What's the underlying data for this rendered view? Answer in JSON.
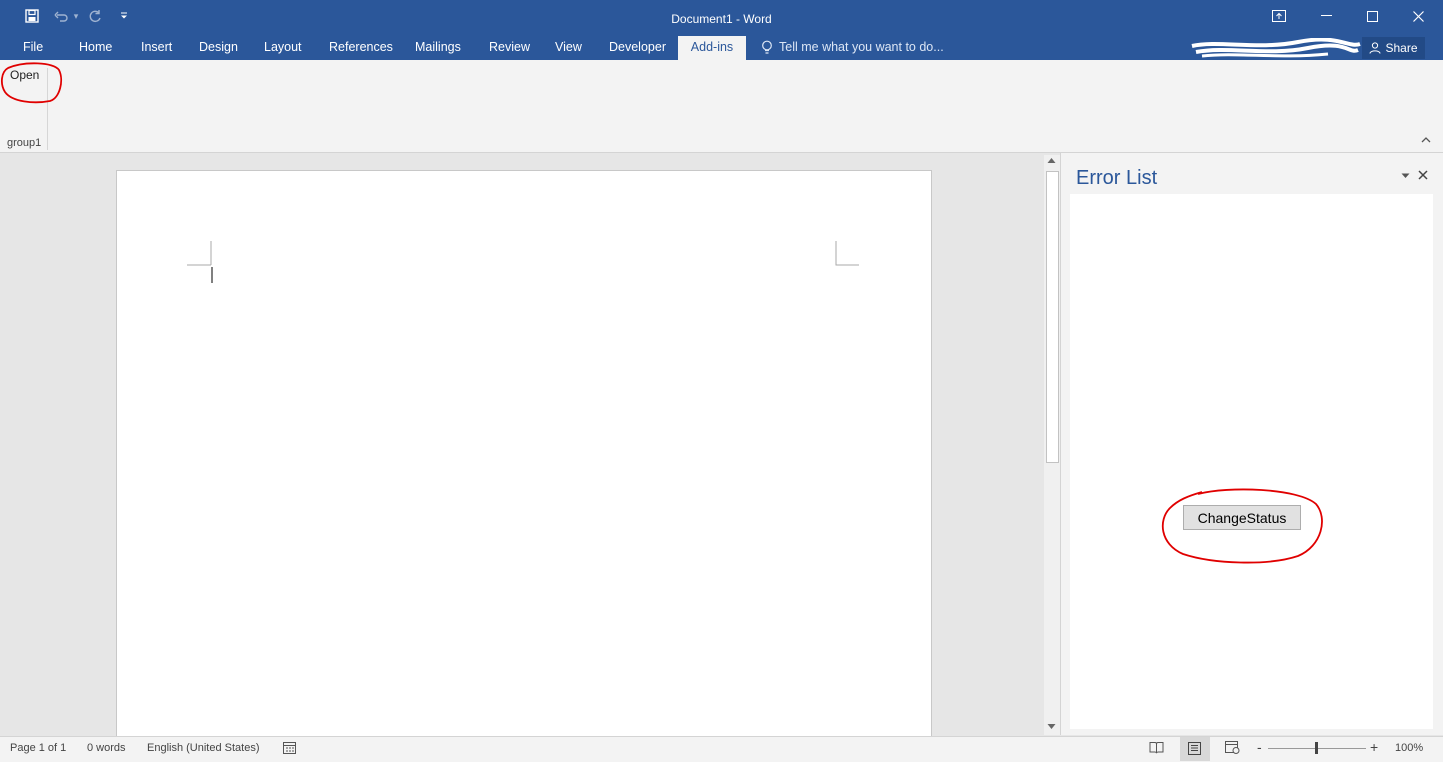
{
  "window": {
    "title": "Document1 - Word"
  },
  "quick_access": {
    "icons": [
      "save-icon",
      "undo-icon",
      "redo-icon",
      "customize-icon"
    ]
  },
  "window_controls": {
    "icons": [
      "ribbon-display-icon",
      "minimize-icon",
      "maximize-icon",
      "close-icon"
    ]
  },
  "ribbon": {
    "tabs": [
      {
        "label": "File"
      },
      {
        "label": "Home"
      },
      {
        "label": "Insert"
      },
      {
        "label": "Design"
      },
      {
        "label": "Layout"
      },
      {
        "label": "References"
      },
      {
        "label": "Mailings"
      },
      {
        "label": "Review"
      },
      {
        "label": "View"
      },
      {
        "label": "Developer"
      },
      {
        "label": "Add-ins"
      }
    ],
    "active_tab": "Add-ins",
    "tell_me": "Tell me what you want to do...",
    "share_label": "Share",
    "open_button": "Open",
    "group_label": "group1"
  },
  "task_pane": {
    "title": "Error List",
    "button_label": "ChangeStatus"
  },
  "status_bar": {
    "page": "Page 1 of 1",
    "words": "0 words",
    "language": "English (United States)",
    "zoom": "100%",
    "zoom_minus": "-",
    "zoom_plus": "+"
  },
  "colors": {
    "accent": "#2b579a",
    "annotation": "#e00000"
  }
}
